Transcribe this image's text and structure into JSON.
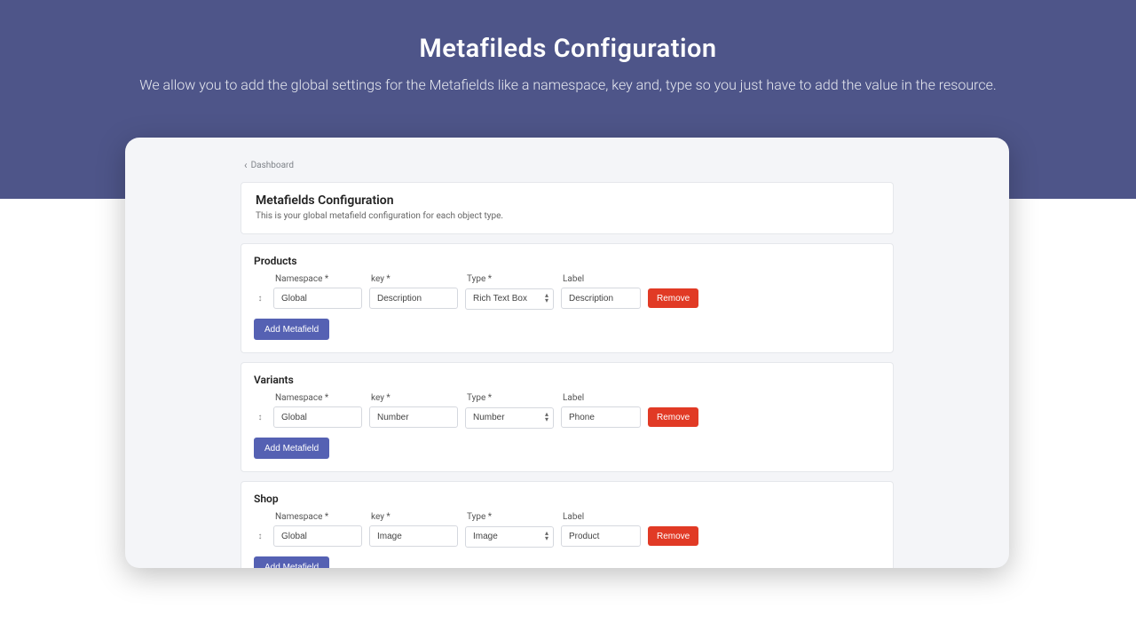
{
  "hero": {
    "title": "Metafileds Configuration",
    "subtitle": "We allow you to add the global settings for the Metafields like a namespace, key and, type so you just have to add the value in the resource."
  },
  "breadcrumb": {
    "label": "Dashboard"
  },
  "panel": {
    "title": "Metafields Configuration",
    "subtitle": "This is your global metafield configuration for each object type."
  },
  "labels": {
    "namespace": "Namespace *",
    "key": "key *",
    "type": "Type *",
    "typelabel": "Label"
  },
  "buttons": {
    "add": "Add Metafield",
    "remove": "Remove"
  },
  "sections": [
    {
      "title": "Products",
      "namespace": "Global",
      "key": "Description",
      "type": "Rich Text Box",
      "label": "Description"
    },
    {
      "title": "Variants",
      "namespace": "Global",
      "key": "Number",
      "type": "Number",
      "label": "Phone"
    },
    {
      "title": "Shop",
      "namespace": "Global",
      "key": "Image",
      "type": "Image",
      "label": "Product"
    }
  ]
}
